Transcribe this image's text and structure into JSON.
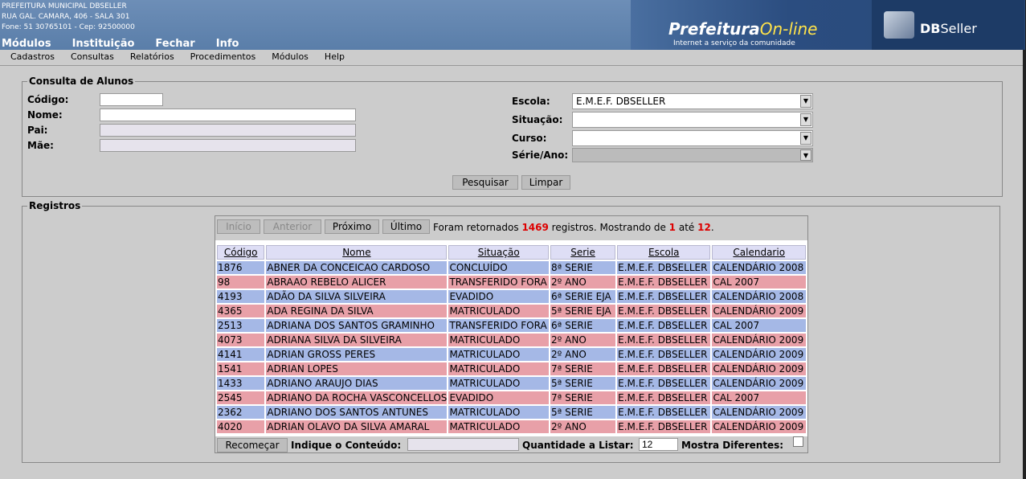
{
  "header": {
    "org": "PREFEITURA MUNICIPAL DBSELLER",
    "address": "RUA GAL. CAMARA, 406 - SALA 301",
    "contact": "Fone: 51 30765101  -  Cep: 92500000",
    "menu": [
      "Módulos",
      "Instituição",
      "Fechar",
      "Info"
    ],
    "brand_a": "Prefeitura",
    "brand_b": "On-line",
    "brand_sub": "Internet a serviço da comunidade",
    "brand2_a": "DB",
    "brand2_b": "Seller"
  },
  "menubar": [
    "Cadastros",
    "Consultas",
    "Relatórios",
    "Procedimentos",
    "Módulos",
    "Help"
  ],
  "consulta": {
    "legend": "Consulta de Alunos",
    "codigo_label": "Código:",
    "nome_label": "Nome:",
    "pai_label": "Pai:",
    "mae_label": "Mãe:",
    "escola_label": "Escola:",
    "escola_value": "E.M.E.F. DBSELLER",
    "situacao_label": "Situação:",
    "curso_label": "Curso:",
    "serie_label": "Série/Ano:",
    "pesquisar": "Pesquisar",
    "limpar": "Limpar"
  },
  "registros": {
    "legend": "Registros",
    "nav": {
      "inicio": "Início",
      "anterior": "Anterior",
      "proximo": "Próximo",
      "ultimo": "Último"
    },
    "count_prefix": "Foram retornados",
    "total": "1469",
    "count_mid": "registros. Mostrando de",
    "from": "1",
    "count_ate": "até",
    "to": "12",
    "count_end": ".",
    "columns": [
      "Código",
      "Nome",
      "Situação",
      "Serie",
      "Escola",
      "Calendario"
    ],
    "rows": [
      [
        "1876",
        "ABNER DA CONCEICAO CARDOSO",
        "CONCLUÍDO",
        "8ª SERIE",
        "E.M.E.F. DBSELLER",
        "CALENDÁRIO 2008"
      ],
      [
        "98",
        "ABRAAO REBELO ALICER",
        "TRANSFERIDO FORA",
        "2º ANO",
        "E.M.E.F. DBSELLER",
        "CAL 2007"
      ],
      [
        "4193",
        "ADÃO DA SILVA SILVEIRA",
        "EVADIDO",
        "6ª SERIE EJA",
        "E.M.E.F. DBSELLER",
        "CALENDÁRIO 2008"
      ],
      [
        "4365",
        "ADA REGINA DA SILVA",
        "MATRICULADO",
        "5ª SERIE EJA",
        "E.M.E.F. DBSELLER",
        "CALENDÁRIO 2009"
      ],
      [
        "2513",
        "ADRIANA DOS SANTOS GRAMINHO",
        "TRANSFERIDO FORA",
        "6ª SERIE",
        "E.M.E.F. DBSELLER",
        "CAL 2007"
      ],
      [
        "4073",
        "ADRIANA SILVA DA SILVEIRA",
        "MATRICULADO",
        "2º ANO",
        "E.M.E.F. DBSELLER",
        "CALENDÁRIO 2009"
      ],
      [
        "4141",
        "ADRIAN GROSS PERES",
        "MATRICULADO",
        "2º ANO",
        "E.M.E.F. DBSELLER",
        "CALENDÁRIO 2009"
      ],
      [
        "1541",
        "ADRIAN LOPES",
        "MATRICULADO",
        "7ª SERIE",
        "E.M.E.F. DBSELLER",
        "CALENDÁRIO 2009"
      ],
      [
        "1433",
        "ADRIANO ARAUJO DIAS",
        "MATRICULADO",
        "5ª SERIE",
        "E.M.E.F. DBSELLER",
        "CALENDÁRIO 2009"
      ],
      [
        "2545",
        "ADRIANO DA ROCHA VASCONCELLOS",
        "EVADIDO",
        "7ª SERIE",
        "E.M.E.F. DBSELLER",
        "CAL 2007"
      ],
      [
        "2362",
        "ADRIANO DOS SANTOS ANTUNES",
        "MATRICULADO",
        "5ª SERIE",
        "E.M.E.F. DBSELLER",
        "CALENDÁRIO 2009"
      ],
      [
        "4020",
        "ADRIAN OLAVO DA SILVA AMARAL",
        "MATRICULADO",
        "2º ANO",
        "E.M.E.F. DBSELLER",
        "CALENDÁRIO 2009"
      ]
    ],
    "recomecar": "Recomeçar",
    "indique_label": "Indique o Conteúdo:",
    "quantidade_label": "Quantidade a Listar:",
    "quantidade_value": "12",
    "mostra_label": "Mostra Diferentes:"
  }
}
